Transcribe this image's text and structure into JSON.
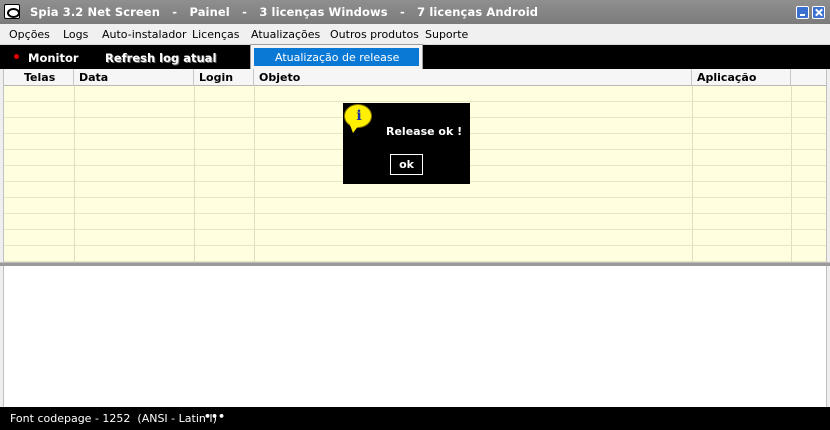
{
  "window": {
    "title": "Spia 3.2 Net Screen   -   Painel   -   3 licenças Windows   -   7 licenças Android"
  },
  "menu": {
    "items": [
      "Opções",
      "Logs",
      "Auto-instalador",
      "Licenças",
      "Atualizações",
      "Outros produtos",
      "Suporte"
    ]
  },
  "dropdown": {
    "item": "Atualização de release"
  },
  "toolbar": {
    "monitor_label": "Monitor",
    "refresh_label": "Refresh log atual"
  },
  "grid": {
    "columns": [
      "Telas",
      "Data",
      "Login",
      "Objeto",
      "Aplicação"
    ],
    "rows": []
  },
  "dialog": {
    "icon": "info-icon",
    "icon_glyph": "i",
    "message": "Release ok !",
    "ok_label": "ok"
  },
  "statusbar": {
    "text": "Font codepage - 1252  (ANSI - Latin I)",
    "more_label": "•••"
  },
  "colors": {
    "titlebar": "#888888",
    "toolbar": "#000000",
    "grid_background": "#ffffe0",
    "menu_highlight": "#0a79d6",
    "monitor_dot": "#e20000",
    "info_icon": "#ffef00"
  }
}
